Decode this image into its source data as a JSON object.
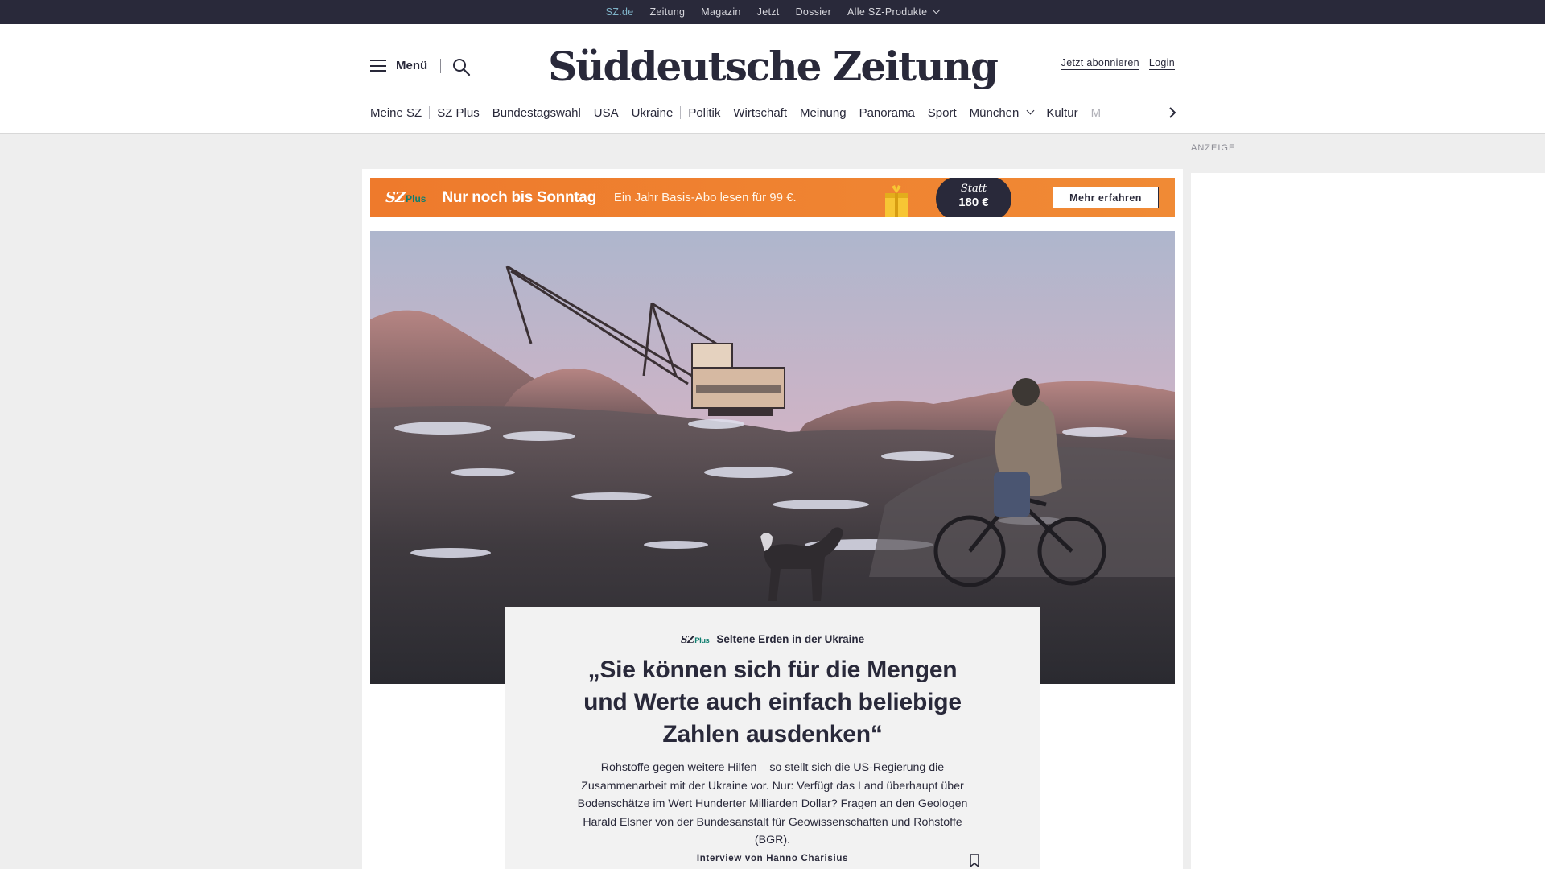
{
  "topbar": {
    "items": [
      {
        "label": "SZ.de"
      },
      {
        "label": "Zeitung"
      },
      {
        "label": "Magazin"
      },
      {
        "label": "Jetzt"
      },
      {
        "label": "Dossier"
      },
      {
        "label": "Alle SZ-Produkte"
      }
    ]
  },
  "header": {
    "menu_label": "Menü",
    "logo": "Süddeutsche Zeitung",
    "subscribe_label": "Jetzt abonnieren",
    "login_label": "Login"
  },
  "nav": {
    "items": [
      "Meine SZ",
      "SZ Plus",
      "Bundestagswahl",
      "USA",
      "Ukraine",
      "Politik",
      "Wirtschaft",
      "Meinung",
      "Panorama",
      "Sport",
      "München",
      "Kultur",
      "M"
    ]
  },
  "ad": {
    "label": "ANZEIGE"
  },
  "promo": {
    "logo_sz": "SZ",
    "logo_plus": "Plus",
    "title": "Nur noch bis Sonntag",
    "subtitle": "Ein Jahr Basis-Abo lesen für 99 €.",
    "badge_statt": "Statt",
    "badge_price": "180 €",
    "cta": "Mehr erfahren",
    "color": "#ee7a2c"
  },
  "article": {
    "kicker_sz": "SZ",
    "kicker_plus": "Plus",
    "kicker": "Seltene Erden in der Ukraine",
    "headline": "„Sie können sich für die Mengen und Werte auch einfach beliebige Zahlen ausdenken“",
    "summary": "Rohstoffe gegen weitere Hilfen – so stellt sich die US-Regierung die Zusammenarbeit mit der Ukraine vor. Nur: Verfügt das Land überhaupt über Bodenschätze im Wert Hunderter Milliarden Dollar? Fragen an den Geologen Harald Elsner von der Bundesanstalt für Geowissenschaften und Rohstoffe (BGR).",
    "byline": "Interview von Hanno Charisius"
  },
  "colors": {
    "dark": "#29293a",
    "accent_teal": "#0f7e6f",
    "active_top": "#7fb3c8"
  }
}
